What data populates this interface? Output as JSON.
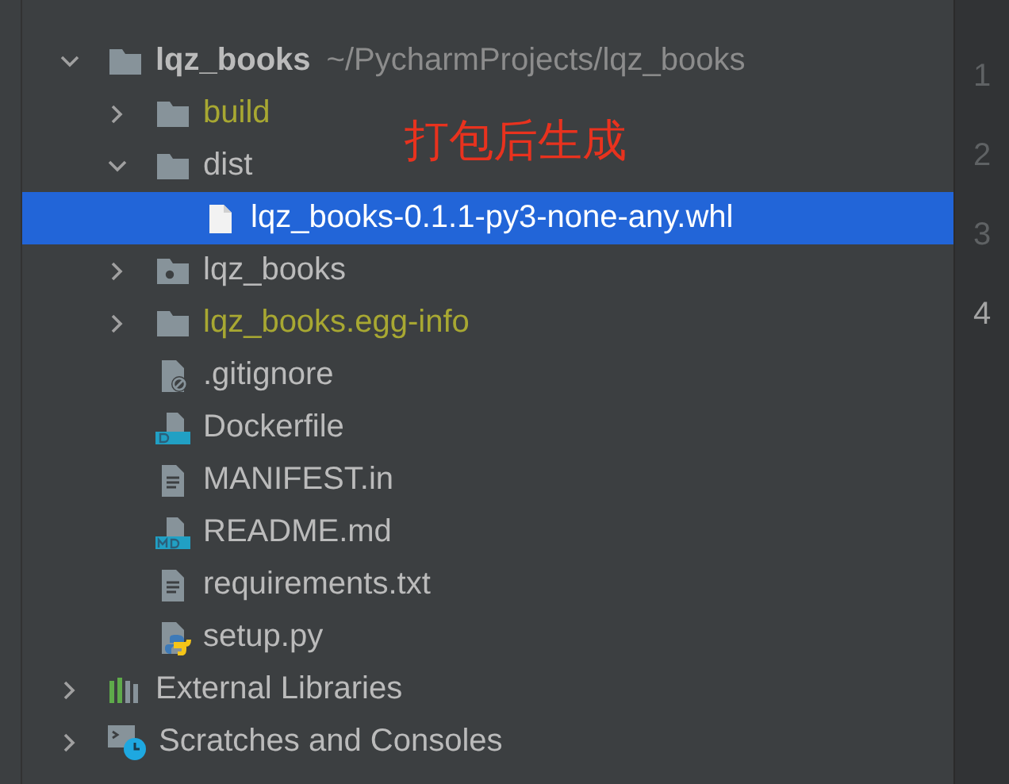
{
  "project_tree": {
    "annotation": "打包后生成",
    "items": [
      {
        "name": "lqz_books",
        "kind": "folder",
        "path": "~/PycharmProjects/lqz_books",
        "expanded": true,
        "selected": false,
        "children": [
          {
            "name": "build",
            "kind": "folder",
            "expanded": false,
            "selected": false,
            "color": "#a8a832"
          },
          {
            "name": "dist",
            "kind": "folder",
            "expanded": true,
            "selected": false,
            "children": [
              {
                "name": "lqz_books-0.1.1-py3-none-any.whl",
                "kind": "file",
                "selected": true
              }
            ]
          },
          {
            "name": "lqz_books",
            "kind": "package",
            "expanded": false,
            "selected": false
          },
          {
            "name": "lqz_books.egg-info",
            "kind": "folder",
            "expanded": false,
            "selected": false,
            "color": "#a8a832"
          },
          {
            "name": ".gitignore",
            "kind": "ignore",
            "selected": false
          },
          {
            "name": "Dockerfile",
            "kind": "docker",
            "selected": false
          },
          {
            "name": "MANIFEST.in",
            "kind": "text",
            "selected": false
          },
          {
            "name": "README.md",
            "kind": "markdown",
            "selected": false
          },
          {
            "name": "requirements.txt",
            "kind": "text",
            "selected": false
          },
          {
            "name": "setup.py",
            "kind": "python",
            "selected": false
          }
        ]
      },
      {
        "name": "External Libraries",
        "kind": "libraries",
        "expanded": false,
        "selected": false
      },
      {
        "name": "Scratches and Consoles",
        "kind": "scratches",
        "expanded": false,
        "selected": false
      }
    ]
  },
  "editor_gutter": {
    "lines": [
      {
        "number": "1",
        "current": false
      },
      {
        "number": "2",
        "current": false
      },
      {
        "number": "3",
        "current": false
      },
      {
        "number": "4",
        "current": true
      }
    ]
  }
}
